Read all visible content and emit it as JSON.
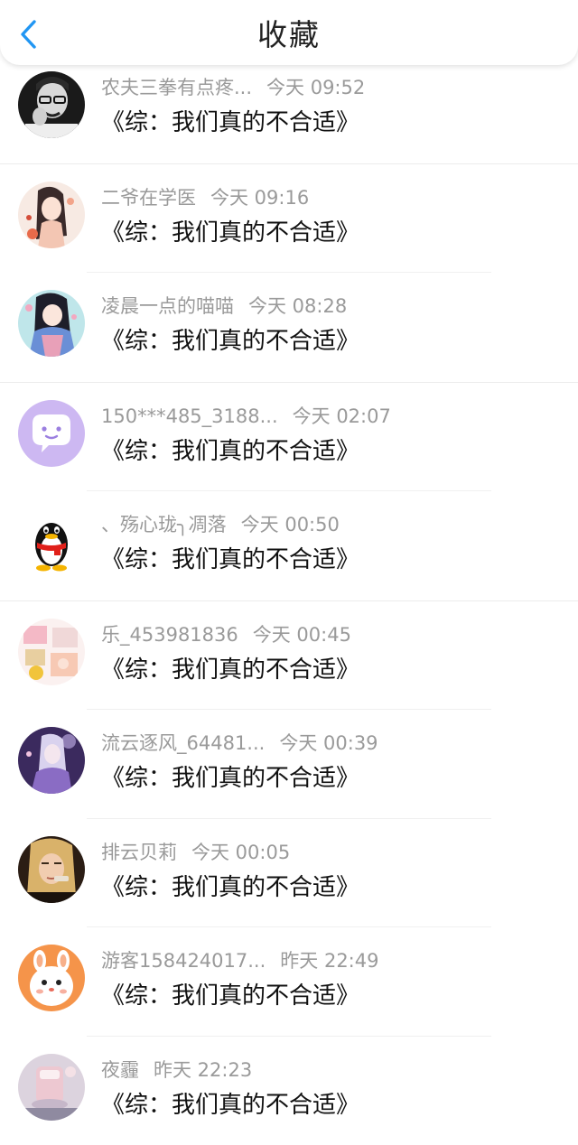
{
  "header": {
    "title": "收藏",
    "back_icon": "chevron-left-icon",
    "accent": "#2196F3"
  },
  "items": [
    {
      "user": "农夫三拳有点疼...",
      "time": "今天 09:52",
      "book": "《综：我们真的不合适》",
      "avatar": "photo-man-glasses"
    },
    {
      "user": "二爷在学医",
      "time": "今天 09:16",
      "book": "《综：我们真的不合适》",
      "avatar": "illustration-girl-flowers"
    },
    {
      "user": "凌晨一点的喵喵",
      "time": "今天 08:28",
      "book": "《综：我们真的不合适》",
      "avatar": "illustration-girl-kimono"
    },
    {
      "user": "150***485_3188...",
      "time": "今天 02:07",
      "book": "《综：我们真的不合适》",
      "avatar": "purple-chat-face"
    },
    {
      "user": "、殇心珑╮凋落",
      "time": "今天 00:50",
      "book": "《综：我们真的不合适》",
      "avatar": "qq-penguin"
    },
    {
      "user": "乐_453981836",
      "time": "今天 00:45",
      "book": "《综：我们真的不合适》",
      "avatar": "collage-pink"
    },
    {
      "user": "流云逐风_64481...",
      "time": "今天 00:39",
      "book": "《综：我们真的不合适》",
      "avatar": "illustration-purple-night"
    },
    {
      "user": "排云贝莉",
      "time": "今天 00:05",
      "book": "《综：我们真的不合适》",
      "avatar": "photo-blonde-woman"
    },
    {
      "user": "游客158424017...",
      "time": "昨天 22:49",
      "book": "《综：我们真的不合适》",
      "avatar": "cartoon-bunny"
    },
    {
      "user": "夜霾",
      "time": "昨天 22:23",
      "book": "《综：我们真的不合适》",
      "avatar": "photo-pink-glass"
    }
  ]
}
